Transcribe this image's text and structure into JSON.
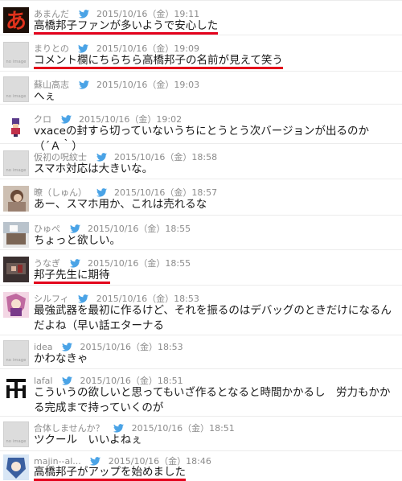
{
  "colors": {
    "highlight_underline": "#e3001b",
    "twitter_blue": "#4aa3e6",
    "meta_gray": "#8c8c8c"
  },
  "posts": [
    {
      "user": "あまんだ",
      "date": "2015/10/16（金）19:11",
      "text": "高橋邦子ファンが多いようで安心した",
      "avatar": "red-a-logo"
    },
    {
      "user": "まりとの",
      "date": "2015/10/16（金）19:09",
      "text": "コメント欄にちらちら高橋邦子の名前が見えて笑う",
      "avatar": "no-image"
    },
    {
      "user": "蘇山高志",
      "date": "2015/10/16（金）19:03",
      "text": "へぇ",
      "avatar": "no-image"
    },
    {
      "user": "クロ",
      "date": "2015/10/16（金）19:02",
      "text": "vxaceの封すら切っていないうちにとうとう次バージョンが出るのか（´Ａ｀）",
      "avatar": "pixel-character"
    },
    {
      "user": "仮初の呪紋士",
      "date": "2015/10/16（金）18:58",
      "text": "スマホ対応は大きいな。",
      "avatar": "no-image"
    },
    {
      "user": "暸（しゅん）",
      "date": "2015/10/16（金）18:57",
      "text": "あー、スマホ用か、これは売れるな",
      "avatar": "photo"
    },
    {
      "user": "ひゅぺ",
      "date": "2015/10/16（金）18:55",
      "text": "ちょっと欲しい。",
      "avatar": "photo-room"
    },
    {
      "user": "うなぎ",
      "date": "2015/10/16（金）18:55",
      "text": "邦子先生に期待",
      "avatar": "photo-dark"
    },
    {
      "user": "シルフィ",
      "date": "2015/10/16（金）18:53",
      "text": "最強武器を最初に作るけど、それを振るのはデバッグのときだけになるんだよね（早い話エターナる",
      "avatar": "anime-girl"
    },
    {
      "user": "idea",
      "date": "2015/10/16（金）18:53",
      "text": "かわなきゃ",
      "avatar": "no-image"
    },
    {
      "user": "lafal",
      "date": "2015/10/16（金）18:51",
      "text": "こういうの欲しいと思ってもいざ作るとなると時間かかるし　労力もかかる完成まで持っていくのが",
      "avatar": "black-glyph"
    },
    {
      "user": "合体しませんか？",
      "date": "2015/10/16（金）18:51",
      "text": "ツクール　いいよねぇ",
      "avatar": "no-image"
    },
    {
      "user": "majin--al...",
      "date": "2015/10/16（金）18:46",
      "text": "高橋邦子がアップを始めました",
      "avatar": "anime-blue"
    }
  ]
}
